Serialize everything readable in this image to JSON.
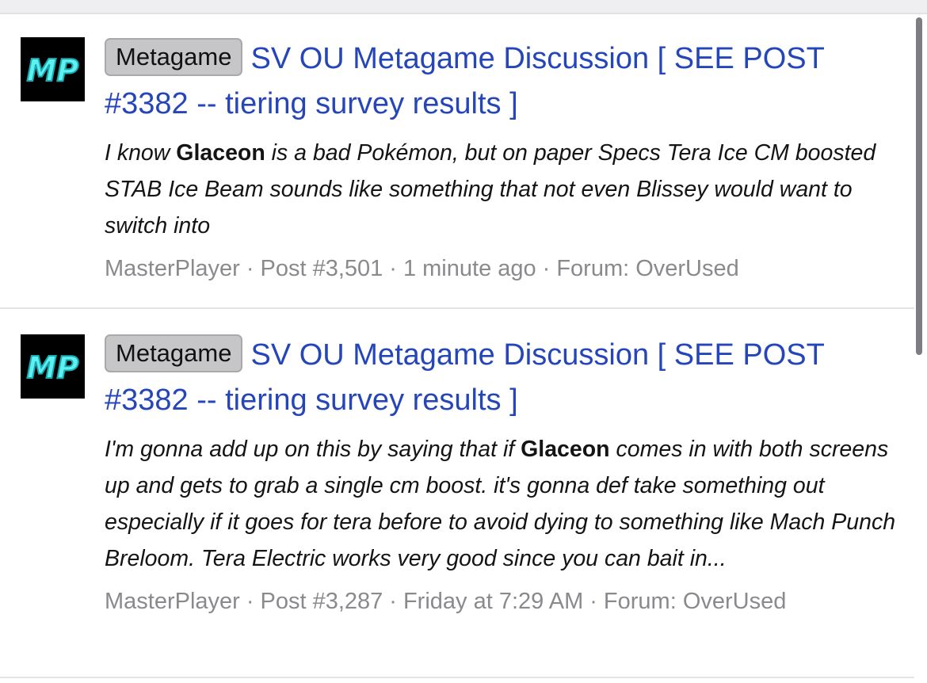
{
  "results": [
    {
      "avatar_text": "MP",
      "badge": "Metagame",
      "title": "SV OU Metagame Discussion [ SEE POST #3382 -- tiering survey results ]",
      "snippet_before": "I know ",
      "snippet_highlight": "Glaceon",
      "snippet_after": " is a bad Pokémon, but on paper Specs Tera Ice CM boosted STAB Ice Beam sounds like something that not even Blissey would want to switch into",
      "author": "MasterPlayer",
      "post": "Post #3,501",
      "time": "1 minute ago",
      "forum": "Forum: OverUsed"
    },
    {
      "avatar_text": "MP",
      "badge": "Metagame",
      "title": "SV OU Metagame Discussion [ SEE POST #3382 -- tiering survey results ]",
      "snippet_before": "I'm gonna add up on this by saying that if ",
      "snippet_highlight": "Glaceon",
      "snippet_after": " comes in with both screens up and gets to grab a single cm boost. it's gonna def take something out especially if it goes for tera before to avoid dying to something like Mach Punch Breloom. Tera Electric works very good since you can bait in...",
      "author": "MasterPlayer",
      "post": "Post #3,287",
      "time": "Friday at 7:29 AM",
      "forum": "Forum: OverUsed"
    }
  ],
  "meta_separator": "·",
  "colors": {
    "link": "#2546b8",
    "badge_bg": "#c6c6c8",
    "meta": "#8a8a8e",
    "avatar_bg": "#000000",
    "avatar_text": "#5ff0f0"
  }
}
